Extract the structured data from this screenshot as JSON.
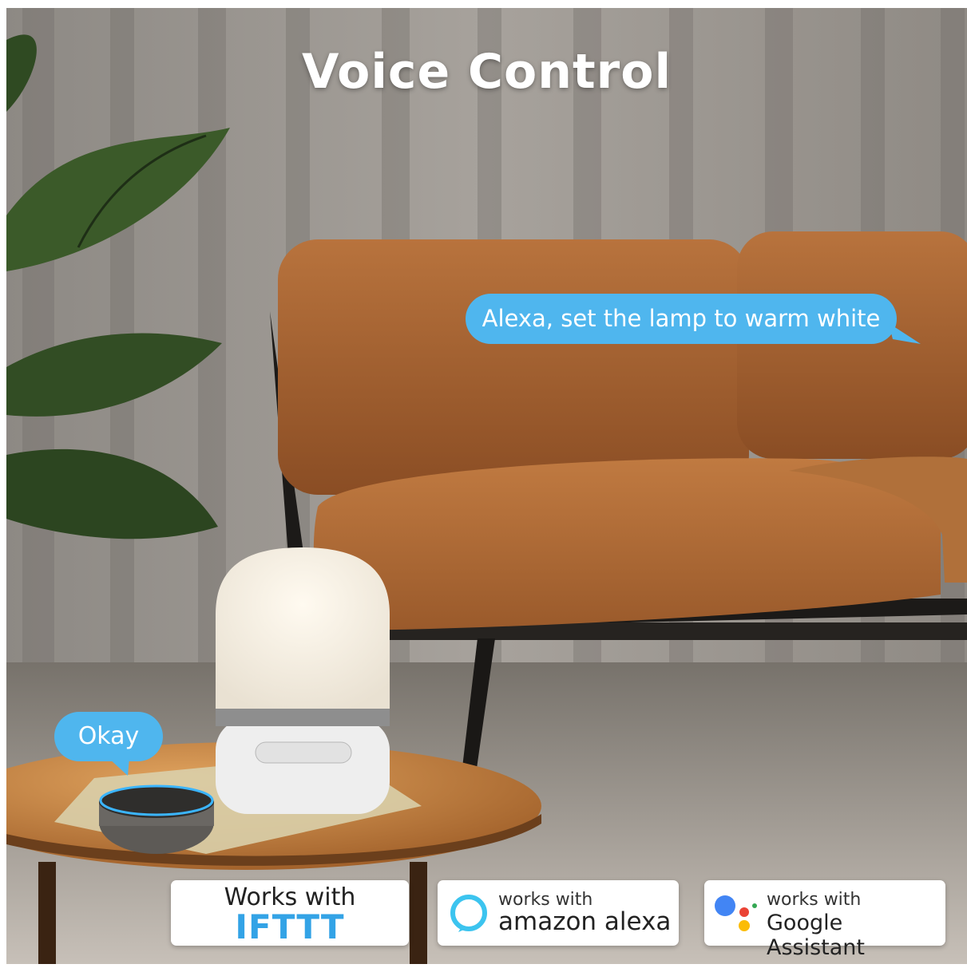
{
  "title": "Voice Control",
  "bubbles": {
    "alexa_command": "Alexa, set the lamp to warm white",
    "reply": "Okay",
    "color": "#4fb6ee"
  },
  "badges": {
    "ifttt": {
      "line1": "Works with",
      "line2": "IFTTT",
      "color": "#33a3e6"
    },
    "alexa": {
      "line1": "works with",
      "line2": "amazon alexa",
      "icon": "alexa-ring-icon"
    },
    "google": {
      "line1": "works with",
      "line2": "Google Assistant",
      "icon": "google-assistant-icon"
    }
  }
}
